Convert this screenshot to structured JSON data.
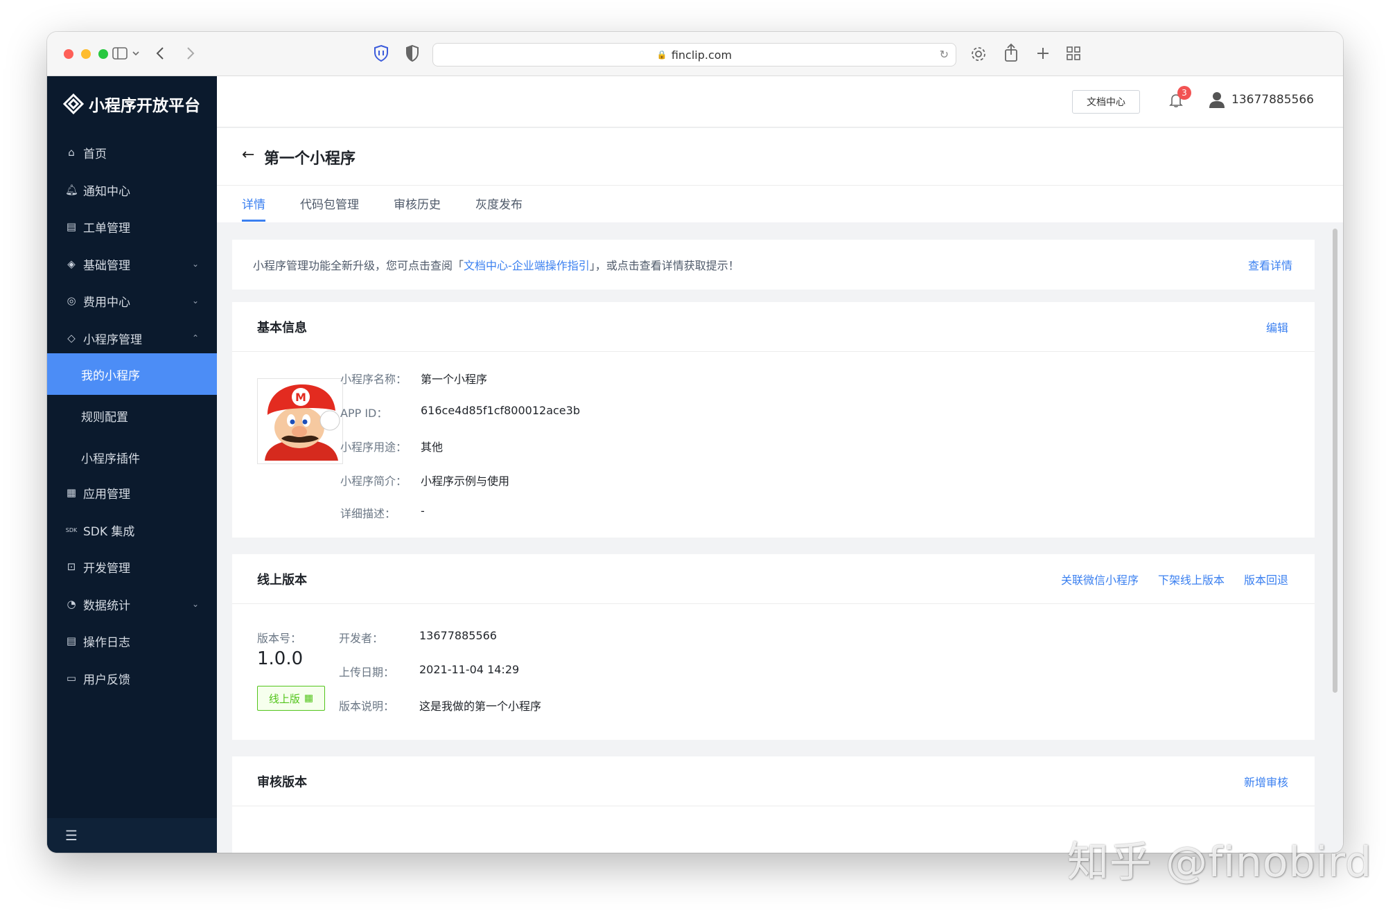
{
  "browser": {
    "url": "finclip.com",
    "icons": [
      "sidebar-toggle-icon",
      "chevron-down-icon",
      "back-icon",
      "forward-icon",
      "shield-icon",
      "privacy-icon",
      "lock-icon",
      "reload-icon",
      "settings-icon",
      "share-icon",
      "new-tab-icon",
      "tab-overview-icon"
    ]
  },
  "sidebar": {
    "logo_text": "小程序开放平台",
    "items": [
      {
        "label": "首页",
        "icon": "home-icon"
      },
      {
        "label": "通知中心",
        "icon": "bell-icon"
      },
      {
        "label": "工单管理",
        "icon": "ticket-icon"
      },
      {
        "label": "基础管理",
        "icon": "layers-icon"
      },
      {
        "label": "费用中心",
        "icon": "coin-icon"
      },
      {
        "label": "小程序管理",
        "icon": "miniapp-icon"
      },
      {
        "label": "应用管理",
        "icon": "grid-icon"
      },
      {
        "label": "SDK 集成",
        "icon": "sdk-icon"
      },
      {
        "label": "开发管理",
        "icon": "code-icon"
      },
      {
        "label": "数据统计",
        "icon": "pie-chart-icon"
      },
      {
        "label": "操作日志",
        "icon": "log-icon"
      },
      {
        "label": "用户反馈",
        "icon": "feedback-icon"
      }
    ],
    "sub_items": [
      "我的小程序",
      "规则配置",
      "小程序插件"
    ],
    "sdk_icon_text": "SDK",
    "accent_color": "#4c8df6",
    "background_color": "#0b1a2d"
  },
  "header": {
    "doc_button": "文档中心",
    "notification_count": "3",
    "user_phone": "13677885566"
  },
  "page": {
    "title": "第一个小程序",
    "tabs": [
      "详情",
      "代码包管理",
      "审核历史",
      "灰度发布"
    ]
  },
  "notice": {
    "text_before": "小程序管理功能全新升级，您可点击查阅「",
    "link": "文档中心-企业端操作指引",
    "text_after": "」，或点击查看详情获取提示！",
    "more": "查看详情"
  },
  "basic_info": {
    "title": "基本信息",
    "edit": "编辑",
    "fields": [
      {
        "label": "小程序名称：",
        "value": "第一个小程序"
      },
      {
        "label": "APP ID：",
        "value": "616ce4d85f1cf800012ace3b"
      },
      {
        "label": "小程序用途：",
        "value": "其他"
      },
      {
        "label": "小程序简介：",
        "value": "小程序示例与使用"
      },
      {
        "label": "详细描述：",
        "value": "-"
      }
    ]
  },
  "online_version": {
    "title": "线上版本",
    "actions": [
      "关联微信小程序",
      "下架线上版本",
      "版本回退"
    ],
    "version_label": "版本号：",
    "version": "1.0.0",
    "tag": "线上版",
    "fields": [
      {
        "label": "开发者：",
        "value": "13677885566"
      },
      {
        "label": "上传日期：",
        "value": "2021-11-04 14:29"
      },
      {
        "label": "版本说明：",
        "value": "这是我做的第一个小程序"
      }
    ]
  },
  "review_version": {
    "title": "审核版本",
    "action": "新增审核"
  },
  "watermark": "知乎 @finobird"
}
